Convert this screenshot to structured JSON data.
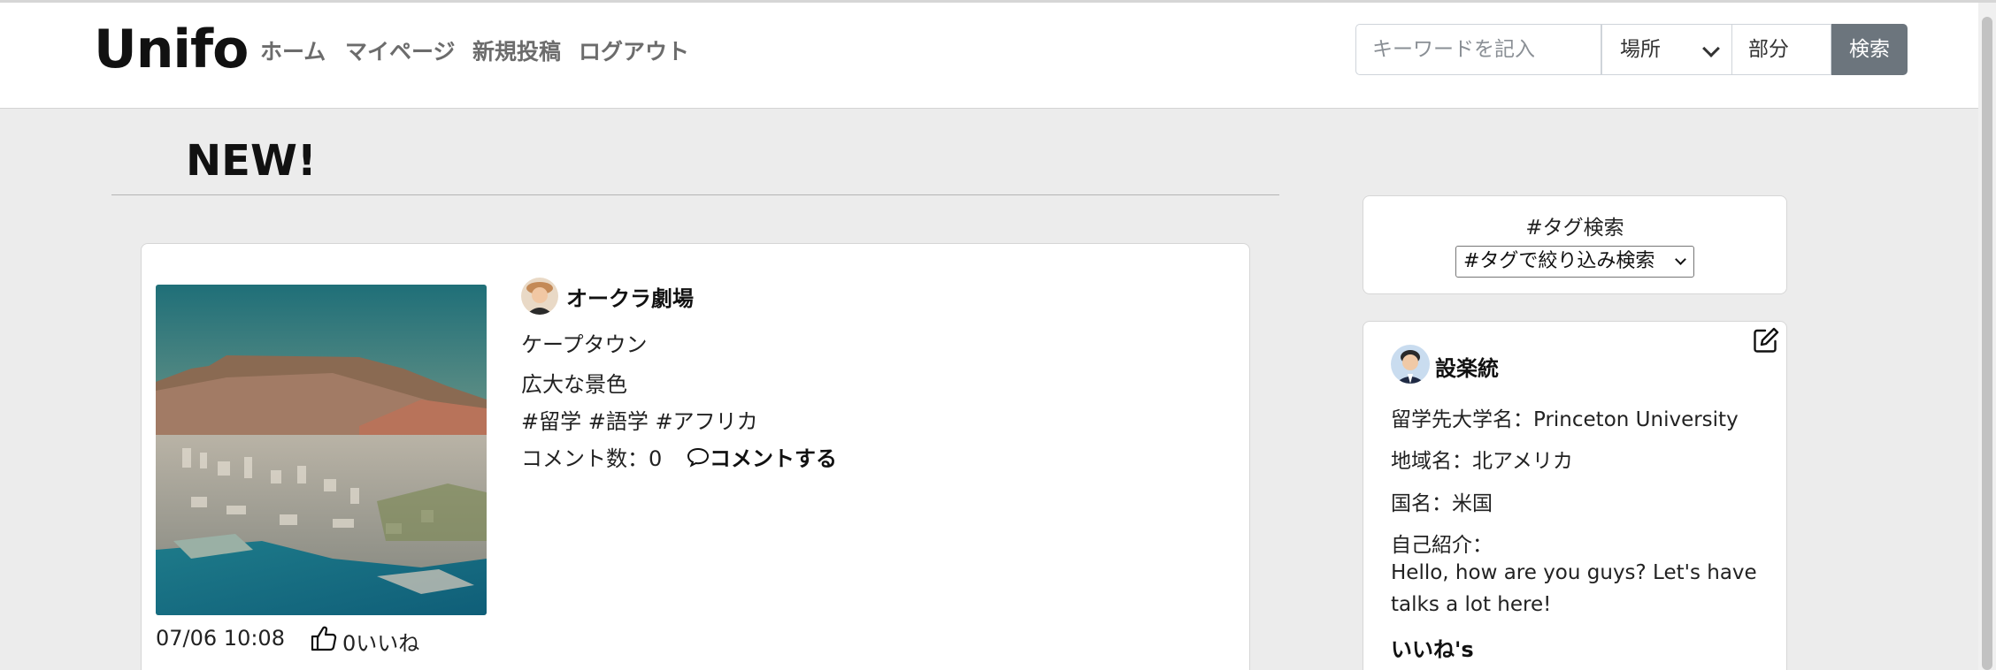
{
  "header": {
    "brand": "Unifo",
    "nav": [
      "ホーム",
      "マイページ",
      "新規投稿",
      "ログアウト"
    ],
    "search_placeholder": "キーワードを記入",
    "place_select": "場所",
    "part_input": "部分",
    "search_button": "検索"
  },
  "main": {
    "heading": "NEW!"
  },
  "post": {
    "user_name": "オークラ劇場",
    "place": "ケープタウン",
    "description": "広大な景色",
    "tags": "#留学 #語学 #アフリカ",
    "comment_count": "コメント数：0",
    "comment_action": "コメントする",
    "date": "07/06 10:08",
    "like_count": "0いいね"
  },
  "sidebar": {
    "tag_search_title": "#タグ検索",
    "tag_select": "#タグで絞り込み検索",
    "profile": {
      "name": "設楽統",
      "university": "留学先大学名：Princeton University",
      "region": "地域名：北アメリカ",
      "country": "国名：米国",
      "intro_label": "自己紹介：",
      "intro_text": "Hello, how are you guys? Let's have talks a lot here!",
      "likes_heading": "いいね's"
    }
  },
  "colors": {
    "navbar_bg": "#ffffff",
    "page_bg": "#ececec",
    "search_button_bg": "#6c757d",
    "nav_link": "#6c6c6c"
  },
  "icons": [
    "comment-icon",
    "thumbs-up-icon",
    "edit-icon",
    "chevron-down-icon"
  ]
}
